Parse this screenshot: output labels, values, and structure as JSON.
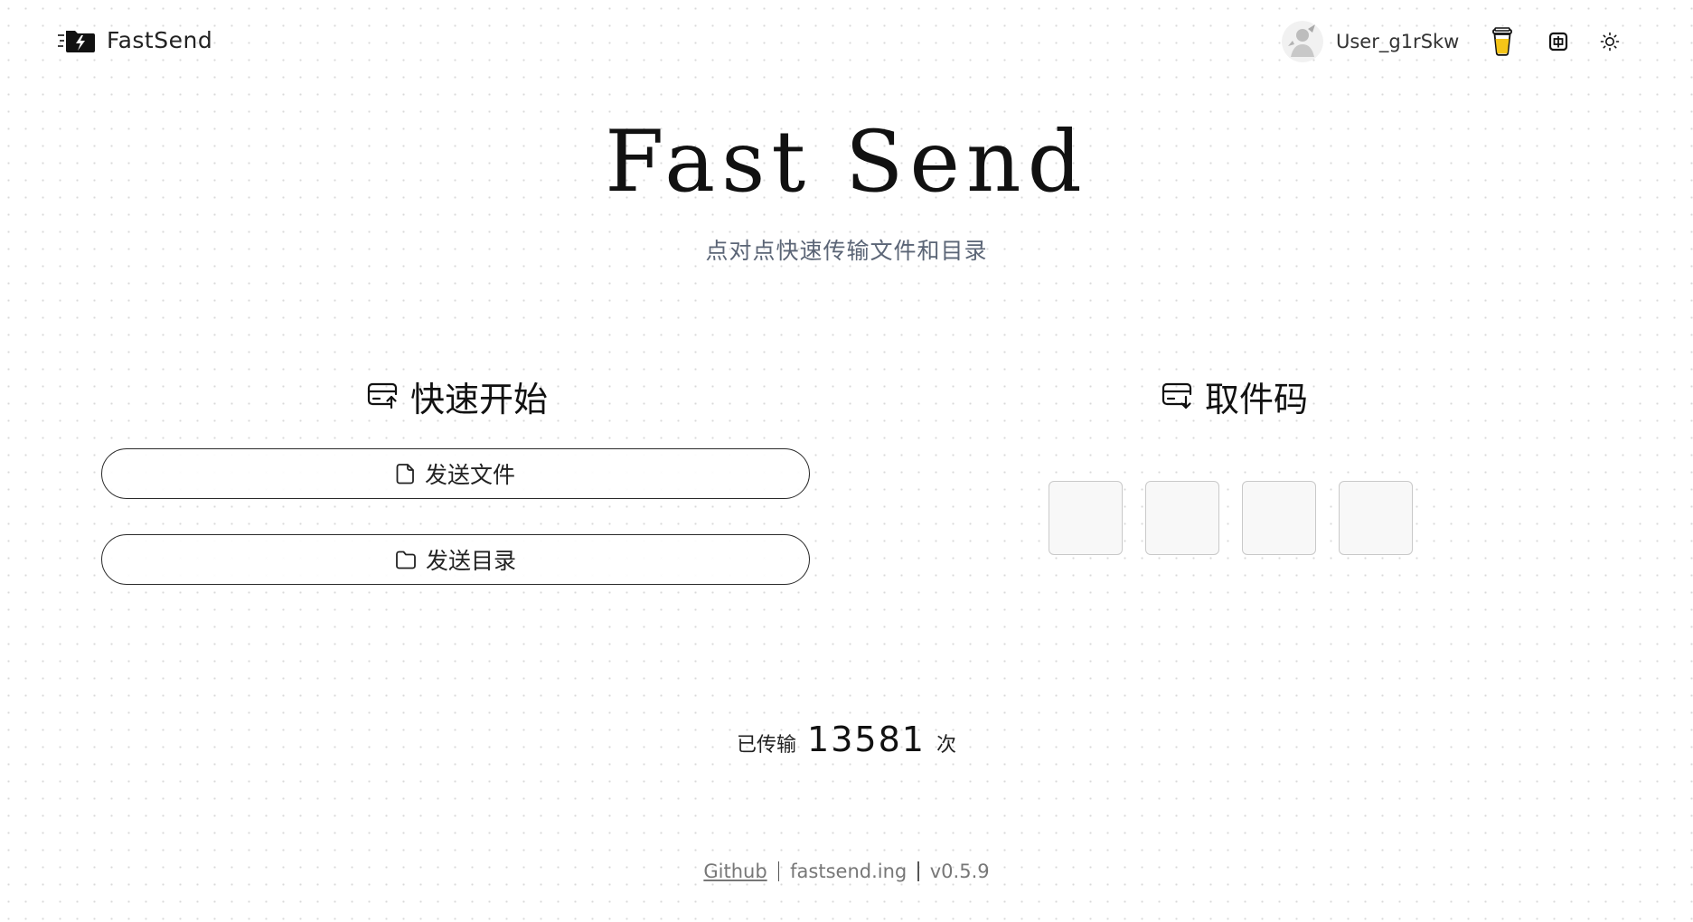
{
  "header": {
    "brand_name": "FastSend",
    "user_name": "User_g1rSkw",
    "icons": {
      "logo": "folder-lightning-icon",
      "coffee": "coffee-cup-icon",
      "language": "language-zh-icon",
      "theme": "sun-icon"
    }
  },
  "hero": {
    "title": "Fast Send",
    "subtitle": "点对点快速传输文件和目录"
  },
  "quick_start": {
    "heading": "快速开始",
    "icon": "send-box-icon",
    "send_file_label": "发送文件",
    "send_file_icon": "file-icon",
    "send_dir_label": "发送目录",
    "send_dir_icon": "folder-icon"
  },
  "pickup": {
    "heading": "取件码",
    "icon": "receive-box-icon",
    "code_values": [
      "",
      "",
      "",
      ""
    ]
  },
  "stats": {
    "label": "已传输",
    "count": "13581",
    "unit": "次"
  },
  "footer": {
    "github_label": "Github",
    "domain": "fastsend.ing",
    "version": "v0.5.9"
  },
  "colors": {
    "text": "#111111",
    "subtitle": "#5b6576",
    "muted": "#777777",
    "coffee_fill": "#f5c518",
    "code_box_border": "#c9c9c9"
  }
}
